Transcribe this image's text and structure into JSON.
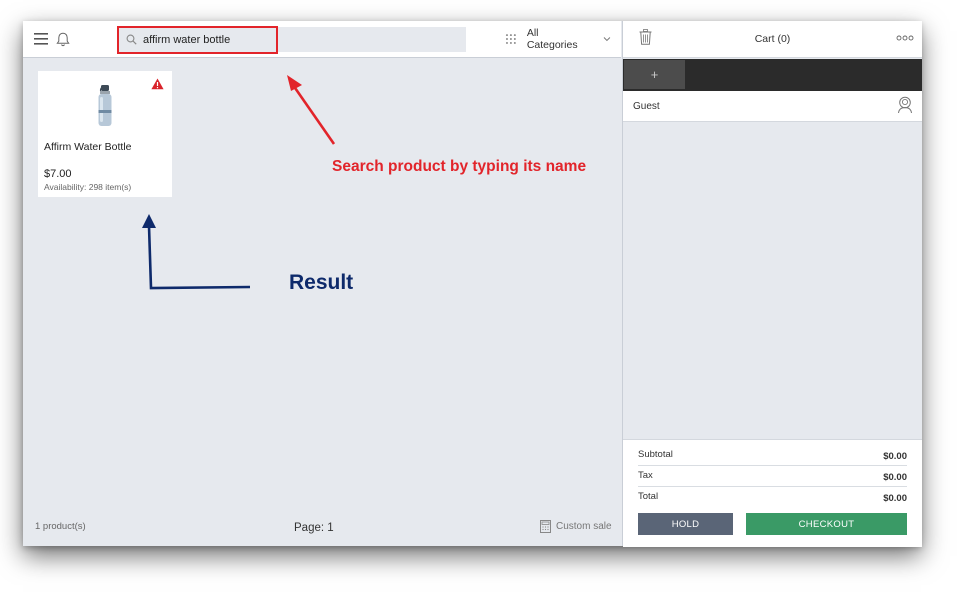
{
  "search": {
    "value": "affirm water bottle",
    "placeholder": ""
  },
  "categories": {
    "label": "All Categories"
  },
  "product": {
    "name": "Affirm Water Bottle",
    "price": "$7.00",
    "availability": "Availability: 298 item(s)",
    "badge_icon": "warning-icon"
  },
  "annotations": {
    "search_hint": "Search product by typing its name",
    "result_label": "Result",
    "search_color": "#e2242a",
    "result_color": "#0e2a6b"
  },
  "footer": {
    "count": "1 product(s)",
    "page": "Page: 1",
    "custom_sale": "Custom sale"
  },
  "cart": {
    "title": "Cart (0)",
    "add_tab_label": "+",
    "customer": "Guest",
    "totals": [
      {
        "label": "Subtotal",
        "value": "$0.00"
      },
      {
        "label": "Tax",
        "value": "$0.00"
      },
      {
        "label": "Total",
        "value": "$0.00"
      }
    ],
    "hold_label": "HOLD",
    "checkout_label": "CHECKOUT"
  },
  "colors": {
    "hold": "#5a6577",
    "checkout": "#3a9a66",
    "tab_bar": "#2b2b2b",
    "background": "#e6e9ee"
  }
}
